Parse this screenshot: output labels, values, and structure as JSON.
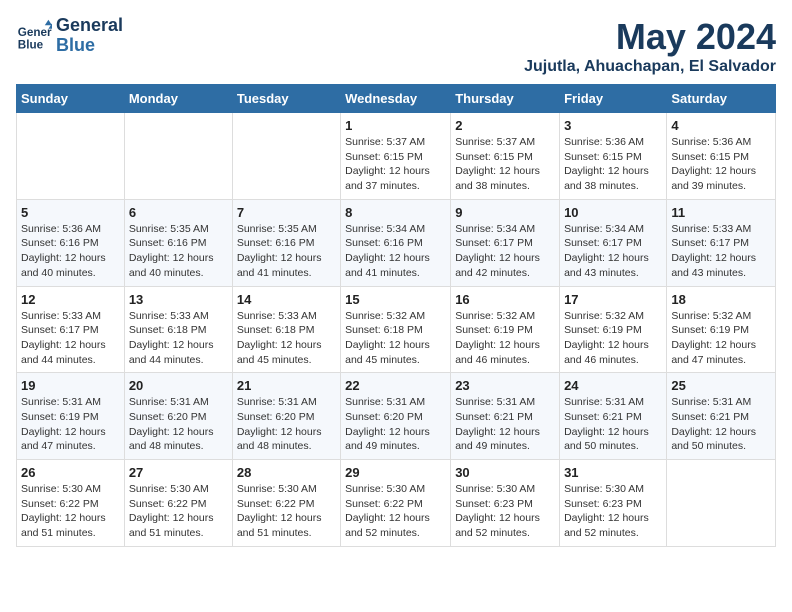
{
  "header": {
    "logo_line1": "General",
    "logo_line2": "Blue",
    "month_title": "May 2024",
    "location": "Jujutla, Ahuachapan, El Salvador"
  },
  "days_of_week": [
    "Sunday",
    "Monday",
    "Tuesday",
    "Wednesday",
    "Thursday",
    "Friday",
    "Saturday"
  ],
  "weeks": [
    [
      {
        "day": "",
        "info": ""
      },
      {
        "day": "",
        "info": ""
      },
      {
        "day": "",
        "info": ""
      },
      {
        "day": "1",
        "info": "Sunrise: 5:37 AM\nSunset: 6:15 PM\nDaylight: 12 hours and 37 minutes."
      },
      {
        "day": "2",
        "info": "Sunrise: 5:37 AM\nSunset: 6:15 PM\nDaylight: 12 hours and 38 minutes."
      },
      {
        "day": "3",
        "info": "Sunrise: 5:36 AM\nSunset: 6:15 PM\nDaylight: 12 hours and 38 minutes."
      },
      {
        "day": "4",
        "info": "Sunrise: 5:36 AM\nSunset: 6:15 PM\nDaylight: 12 hours and 39 minutes."
      }
    ],
    [
      {
        "day": "5",
        "info": "Sunrise: 5:36 AM\nSunset: 6:16 PM\nDaylight: 12 hours and 40 minutes."
      },
      {
        "day": "6",
        "info": "Sunrise: 5:35 AM\nSunset: 6:16 PM\nDaylight: 12 hours and 40 minutes."
      },
      {
        "day": "7",
        "info": "Sunrise: 5:35 AM\nSunset: 6:16 PM\nDaylight: 12 hours and 41 minutes."
      },
      {
        "day": "8",
        "info": "Sunrise: 5:34 AM\nSunset: 6:16 PM\nDaylight: 12 hours and 41 minutes."
      },
      {
        "day": "9",
        "info": "Sunrise: 5:34 AM\nSunset: 6:17 PM\nDaylight: 12 hours and 42 minutes."
      },
      {
        "day": "10",
        "info": "Sunrise: 5:34 AM\nSunset: 6:17 PM\nDaylight: 12 hours and 43 minutes."
      },
      {
        "day": "11",
        "info": "Sunrise: 5:33 AM\nSunset: 6:17 PM\nDaylight: 12 hours and 43 minutes."
      }
    ],
    [
      {
        "day": "12",
        "info": "Sunrise: 5:33 AM\nSunset: 6:17 PM\nDaylight: 12 hours and 44 minutes."
      },
      {
        "day": "13",
        "info": "Sunrise: 5:33 AM\nSunset: 6:18 PM\nDaylight: 12 hours and 44 minutes."
      },
      {
        "day": "14",
        "info": "Sunrise: 5:33 AM\nSunset: 6:18 PM\nDaylight: 12 hours and 45 minutes."
      },
      {
        "day": "15",
        "info": "Sunrise: 5:32 AM\nSunset: 6:18 PM\nDaylight: 12 hours and 45 minutes."
      },
      {
        "day": "16",
        "info": "Sunrise: 5:32 AM\nSunset: 6:19 PM\nDaylight: 12 hours and 46 minutes."
      },
      {
        "day": "17",
        "info": "Sunrise: 5:32 AM\nSunset: 6:19 PM\nDaylight: 12 hours and 46 minutes."
      },
      {
        "day": "18",
        "info": "Sunrise: 5:32 AM\nSunset: 6:19 PM\nDaylight: 12 hours and 47 minutes."
      }
    ],
    [
      {
        "day": "19",
        "info": "Sunrise: 5:31 AM\nSunset: 6:19 PM\nDaylight: 12 hours and 47 minutes."
      },
      {
        "day": "20",
        "info": "Sunrise: 5:31 AM\nSunset: 6:20 PM\nDaylight: 12 hours and 48 minutes."
      },
      {
        "day": "21",
        "info": "Sunrise: 5:31 AM\nSunset: 6:20 PM\nDaylight: 12 hours and 48 minutes."
      },
      {
        "day": "22",
        "info": "Sunrise: 5:31 AM\nSunset: 6:20 PM\nDaylight: 12 hours and 49 minutes."
      },
      {
        "day": "23",
        "info": "Sunrise: 5:31 AM\nSunset: 6:21 PM\nDaylight: 12 hours and 49 minutes."
      },
      {
        "day": "24",
        "info": "Sunrise: 5:31 AM\nSunset: 6:21 PM\nDaylight: 12 hours and 50 minutes."
      },
      {
        "day": "25",
        "info": "Sunrise: 5:31 AM\nSunset: 6:21 PM\nDaylight: 12 hours and 50 minutes."
      }
    ],
    [
      {
        "day": "26",
        "info": "Sunrise: 5:30 AM\nSunset: 6:22 PM\nDaylight: 12 hours and 51 minutes."
      },
      {
        "day": "27",
        "info": "Sunrise: 5:30 AM\nSunset: 6:22 PM\nDaylight: 12 hours and 51 minutes."
      },
      {
        "day": "28",
        "info": "Sunrise: 5:30 AM\nSunset: 6:22 PM\nDaylight: 12 hours and 51 minutes."
      },
      {
        "day": "29",
        "info": "Sunrise: 5:30 AM\nSunset: 6:22 PM\nDaylight: 12 hours and 52 minutes."
      },
      {
        "day": "30",
        "info": "Sunrise: 5:30 AM\nSunset: 6:23 PM\nDaylight: 12 hours and 52 minutes."
      },
      {
        "day": "31",
        "info": "Sunrise: 5:30 AM\nSunset: 6:23 PM\nDaylight: 12 hours and 52 minutes."
      },
      {
        "day": "",
        "info": ""
      }
    ]
  ]
}
